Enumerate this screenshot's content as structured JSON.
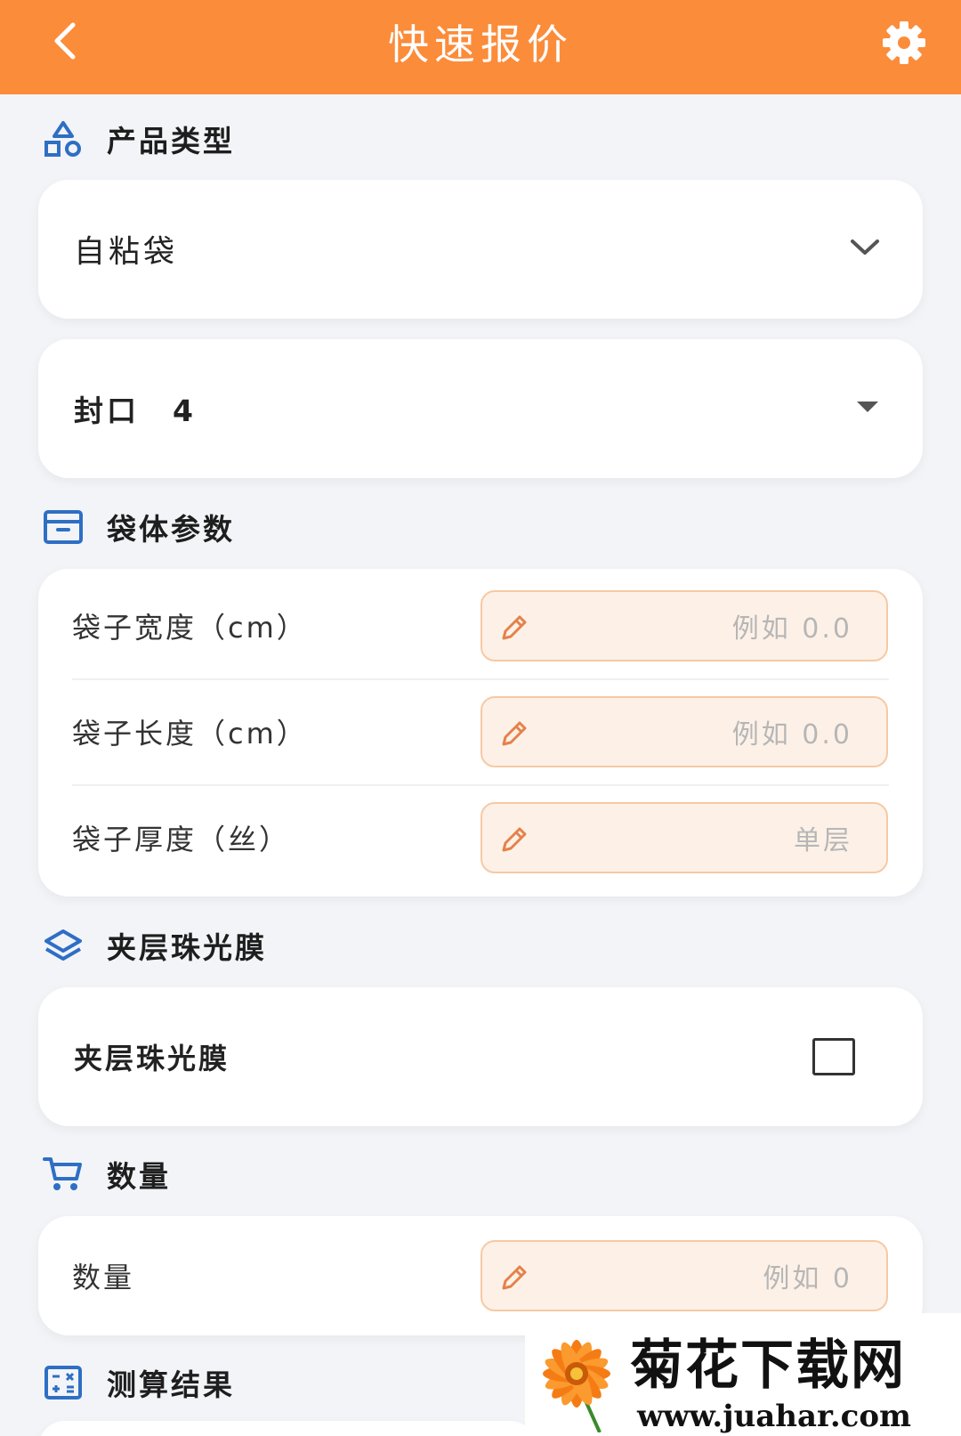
{
  "header": {
    "title": "快速报价"
  },
  "sections": {
    "product_type": "产品类型",
    "bag_params": "袋体参数",
    "pearl_film": "夹层珠光膜",
    "quantity": "数量",
    "result": "测算结果"
  },
  "product_select": {
    "value": "自粘袋"
  },
  "seal_select": {
    "value": "封口　4"
  },
  "bag_fields": [
    {
      "label": "袋子宽度（cm）",
      "placeholder": "例如 0.0"
    },
    {
      "label": "袋子长度（cm）",
      "placeholder": "例如 0.0"
    },
    {
      "label": "袋子厚度（丝）",
      "placeholder": "单层"
    }
  ],
  "pearl_film": {
    "label": "夹层珠光膜",
    "checked": false
  },
  "quantity_field": {
    "label": "数量",
    "placeholder": "例如 0"
  },
  "watermark": {
    "title": "菊花下载网",
    "url": "www.juahar.com"
  },
  "colors": {
    "accent": "#fb8c3a",
    "icon_blue": "#2e6fc4",
    "field_bg": "#fdf1e7",
    "field_border": "#f6c9a4"
  },
  "icons": {
    "back": "chevron-left-icon",
    "settings": "gear-icon",
    "product_type": "shapes-icon",
    "bag_params": "archive-box-icon",
    "pearl_film": "layers-icon",
    "quantity": "cart-icon",
    "result": "calculator-icon"
  }
}
